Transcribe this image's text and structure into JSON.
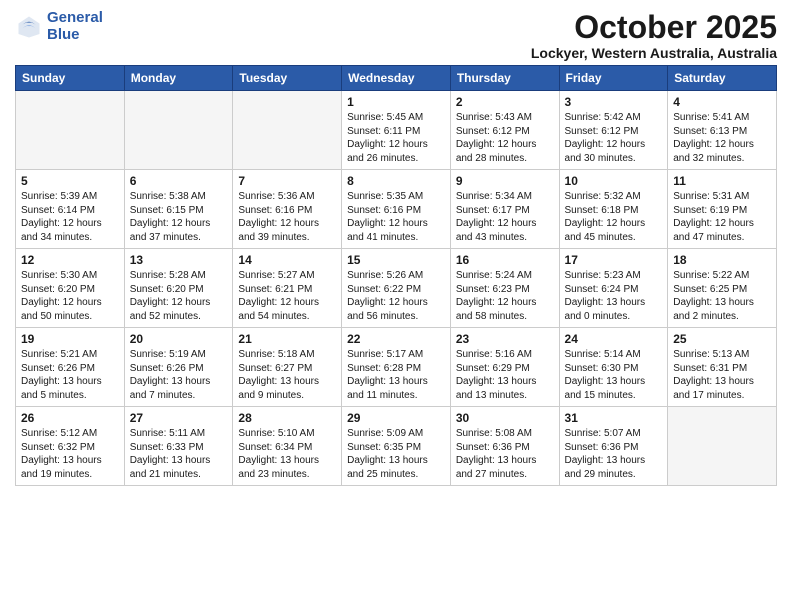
{
  "logo": {
    "line1": "General",
    "line2": "Blue"
  },
  "title": "October 2025",
  "location": "Lockyer, Western Australia, Australia",
  "days_of_week": [
    "Sunday",
    "Monday",
    "Tuesday",
    "Wednesday",
    "Thursday",
    "Friday",
    "Saturday"
  ],
  "weeks": [
    [
      {
        "day": "",
        "info": ""
      },
      {
        "day": "",
        "info": ""
      },
      {
        "day": "",
        "info": ""
      },
      {
        "day": "1",
        "info": "Sunrise: 5:45 AM\nSunset: 6:11 PM\nDaylight: 12 hours\nand 26 minutes."
      },
      {
        "day": "2",
        "info": "Sunrise: 5:43 AM\nSunset: 6:12 PM\nDaylight: 12 hours\nand 28 minutes."
      },
      {
        "day": "3",
        "info": "Sunrise: 5:42 AM\nSunset: 6:12 PM\nDaylight: 12 hours\nand 30 minutes."
      },
      {
        "day": "4",
        "info": "Sunrise: 5:41 AM\nSunset: 6:13 PM\nDaylight: 12 hours\nand 32 minutes."
      }
    ],
    [
      {
        "day": "5",
        "info": "Sunrise: 5:39 AM\nSunset: 6:14 PM\nDaylight: 12 hours\nand 34 minutes."
      },
      {
        "day": "6",
        "info": "Sunrise: 5:38 AM\nSunset: 6:15 PM\nDaylight: 12 hours\nand 37 minutes."
      },
      {
        "day": "7",
        "info": "Sunrise: 5:36 AM\nSunset: 6:16 PM\nDaylight: 12 hours\nand 39 minutes."
      },
      {
        "day": "8",
        "info": "Sunrise: 5:35 AM\nSunset: 6:16 PM\nDaylight: 12 hours\nand 41 minutes."
      },
      {
        "day": "9",
        "info": "Sunrise: 5:34 AM\nSunset: 6:17 PM\nDaylight: 12 hours\nand 43 minutes."
      },
      {
        "day": "10",
        "info": "Sunrise: 5:32 AM\nSunset: 6:18 PM\nDaylight: 12 hours\nand 45 minutes."
      },
      {
        "day": "11",
        "info": "Sunrise: 5:31 AM\nSunset: 6:19 PM\nDaylight: 12 hours\nand 47 minutes."
      }
    ],
    [
      {
        "day": "12",
        "info": "Sunrise: 5:30 AM\nSunset: 6:20 PM\nDaylight: 12 hours\nand 50 minutes."
      },
      {
        "day": "13",
        "info": "Sunrise: 5:28 AM\nSunset: 6:20 PM\nDaylight: 12 hours\nand 52 minutes."
      },
      {
        "day": "14",
        "info": "Sunrise: 5:27 AM\nSunset: 6:21 PM\nDaylight: 12 hours\nand 54 minutes."
      },
      {
        "day": "15",
        "info": "Sunrise: 5:26 AM\nSunset: 6:22 PM\nDaylight: 12 hours\nand 56 minutes."
      },
      {
        "day": "16",
        "info": "Sunrise: 5:24 AM\nSunset: 6:23 PM\nDaylight: 12 hours\nand 58 minutes."
      },
      {
        "day": "17",
        "info": "Sunrise: 5:23 AM\nSunset: 6:24 PM\nDaylight: 13 hours\nand 0 minutes."
      },
      {
        "day": "18",
        "info": "Sunrise: 5:22 AM\nSunset: 6:25 PM\nDaylight: 13 hours\nand 2 minutes."
      }
    ],
    [
      {
        "day": "19",
        "info": "Sunrise: 5:21 AM\nSunset: 6:26 PM\nDaylight: 13 hours\nand 5 minutes."
      },
      {
        "day": "20",
        "info": "Sunrise: 5:19 AM\nSunset: 6:26 PM\nDaylight: 13 hours\nand 7 minutes."
      },
      {
        "day": "21",
        "info": "Sunrise: 5:18 AM\nSunset: 6:27 PM\nDaylight: 13 hours\nand 9 minutes."
      },
      {
        "day": "22",
        "info": "Sunrise: 5:17 AM\nSunset: 6:28 PM\nDaylight: 13 hours\nand 11 minutes."
      },
      {
        "day": "23",
        "info": "Sunrise: 5:16 AM\nSunset: 6:29 PM\nDaylight: 13 hours\nand 13 minutes."
      },
      {
        "day": "24",
        "info": "Sunrise: 5:14 AM\nSunset: 6:30 PM\nDaylight: 13 hours\nand 15 minutes."
      },
      {
        "day": "25",
        "info": "Sunrise: 5:13 AM\nSunset: 6:31 PM\nDaylight: 13 hours\nand 17 minutes."
      }
    ],
    [
      {
        "day": "26",
        "info": "Sunrise: 5:12 AM\nSunset: 6:32 PM\nDaylight: 13 hours\nand 19 minutes."
      },
      {
        "day": "27",
        "info": "Sunrise: 5:11 AM\nSunset: 6:33 PM\nDaylight: 13 hours\nand 21 minutes."
      },
      {
        "day": "28",
        "info": "Sunrise: 5:10 AM\nSunset: 6:34 PM\nDaylight: 13 hours\nand 23 minutes."
      },
      {
        "day": "29",
        "info": "Sunrise: 5:09 AM\nSunset: 6:35 PM\nDaylight: 13 hours\nand 25 minutes."
      },
      {
        "day": "30",
        "info": "Sunrise: 5:08 AM\nSunset: 6:36 PM\nDaylight: 13 hours\nand 27 minutes."
      },
      {
        "day": "31",
        "info": "Sunrise: 5:07 AM\nSunset: 6:36 PM\nDaylight: 13 hours\nand 29 minutes."
      },
      {
        "day": "",
        "info": ""
      }
    ]
  ]
}
